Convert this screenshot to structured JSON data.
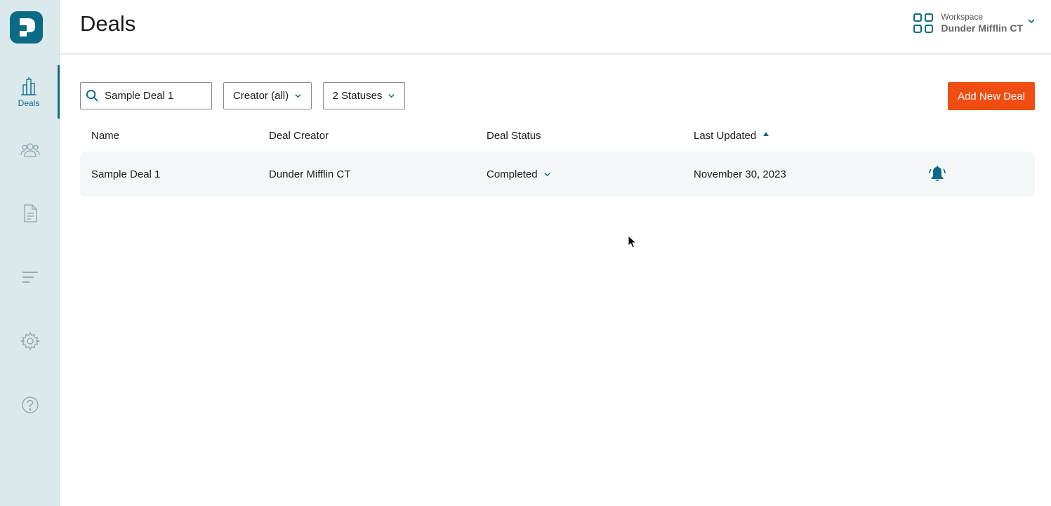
{
  "sidebar": {
    "items": [
      {
        "label": "Deals",
        "icon": "buildings-icon",
        "active": true
      },
      {
        "label": "",
        "icon": "people-icon"
      },
      {
        "label": "",
        "icon": "document-icon"
      },
      {
        "label": "",
        "icon": "lines-icon"
      },
      {
        "label": "",
        "icon": "gear-icon"
      },
      {
        "label": "",
        "icon": "help-icon"
      }
    ]
  },
  "header": {
    "title": "Deals",
    "workspace": {
      "caption": "Workspace",
      "name": "Dunder Mifflin CT"
    }
  },
  "toolbar": {
    "search_value": "Sample Deal 1",
    "creator_filter": "Creator (all)",
    "status_filter": "2 Statuses",
    "add_button": "Add New Deal"
  },
  "table": {
    "columns": [
      "Name",
      "Deal Creator",
      "Deal Status",
      "Last Updated"
    ],
    "sort": {
      "column": "Last Updated",
      "direction": "ascending"
    },
    "rows": [
      {
        "name": "Sample Deal 1",
        "creator": "Dunder Mifflin CT",
        "status": "Completed",
        "last_updated": "November 30, 2023",
        "action_icon": "bell-icon"
      }
    ]
  },
  "colors": {
    "accent": "#0b6b86",
    "primary_button": "#ef4d11",
    "sidebar_bg": "#dbe8ec",
    "row_bg": "#f4f7f8"
  }
}
